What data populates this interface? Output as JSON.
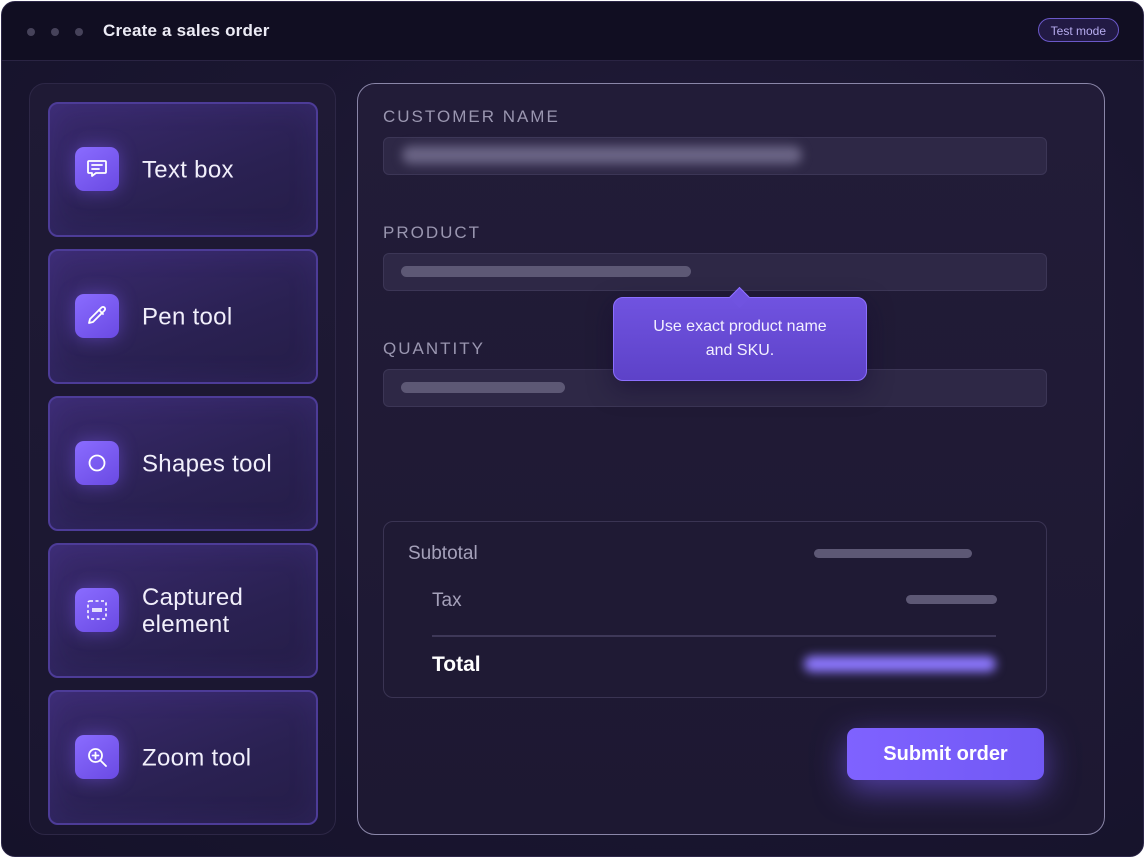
{
  "window": {
    "title": "Create a sales order",
    "mode_badge": "Test mode"
  },
  "sidebar": {
    "tools": [
      {
        "label": "Text box",
        "icon": "message-square-icon"
      },
      {
        "label": "Pen tool",
        "icon": "pencil-icon"
      },
      {
        "label": "Shapes tool",
        "icon": "circle-icon"
      },
      {
        "label": "Captured element",
        "icon": "dashed-rectangle-icon"
      },
      {
        "label": "Zoom tool",
        "icon": "zoom-in-icon"
      }
    ]
  },
  "form": {
    "customer_name_label": "CUSTOMER NAME",
    "product_label": "PRODUCT",
    "quantity_label": "QUANTITY",
    "tooltip_text": "Use exact product name and SKU."
  },
  "summary": {
    "subtotal_label": "Subtotal",
    "tax_label": "Tax",
    "total_label": "Total"
  },
  "actions": {
    "submit_label": "Submit order"
  },
  "colors": {
    "accent": "#7f62ff",
    "background": "#1a1630",
    "tool_border": "#4d3c98"
  }
}
